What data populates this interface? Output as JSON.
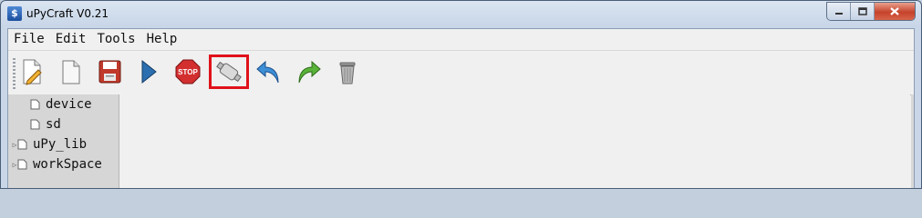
{
  "window": {
    "title": "uPyCraft V0.21",
    "app_icon_glyph": "$",
    "controls": {
      "minimize_icon": "minimize-icon",
      "maximize_icon": "maximize-icon",
      "close_icon": "close-icon"
    }
  },
  "menu": [
    "File",
    "Edit",
    "Tools",
    "Help"
  ],
  "toolbar": [
    {
      "name": "new-file-icon"
    },
    {
      "name": "open-file-icon"
    },
    {
      "name": "save-icon"
    },
    {
      "name": "run-icon"
    },
    {
      "name": "stop-icon",
      "label": "STOP"
    },
    {
      "name": "connect-icon",
      "highlighted": true
    },
    {
      "name": "undo-icon"
    },
    {
      "name": "redo-icon"
    },
    {
      "name": "delete-icon"
    }
  ],
  "tree": [
    {
      "label": "device",
      "expandable": false
    },
    {
      "label": "sd",
      "expandable": false
    },
    {
      "label": "uPy_lib",
      "expandable": true
    },
    {
      "label": "workSpace",
      "expandable": true
    }
  ],
  "colors": {
    "highlight": "#e0121a",
    "tree_bg": "#d6d6d6",
    "titlebar": "#c8d6e8"
  }
}
